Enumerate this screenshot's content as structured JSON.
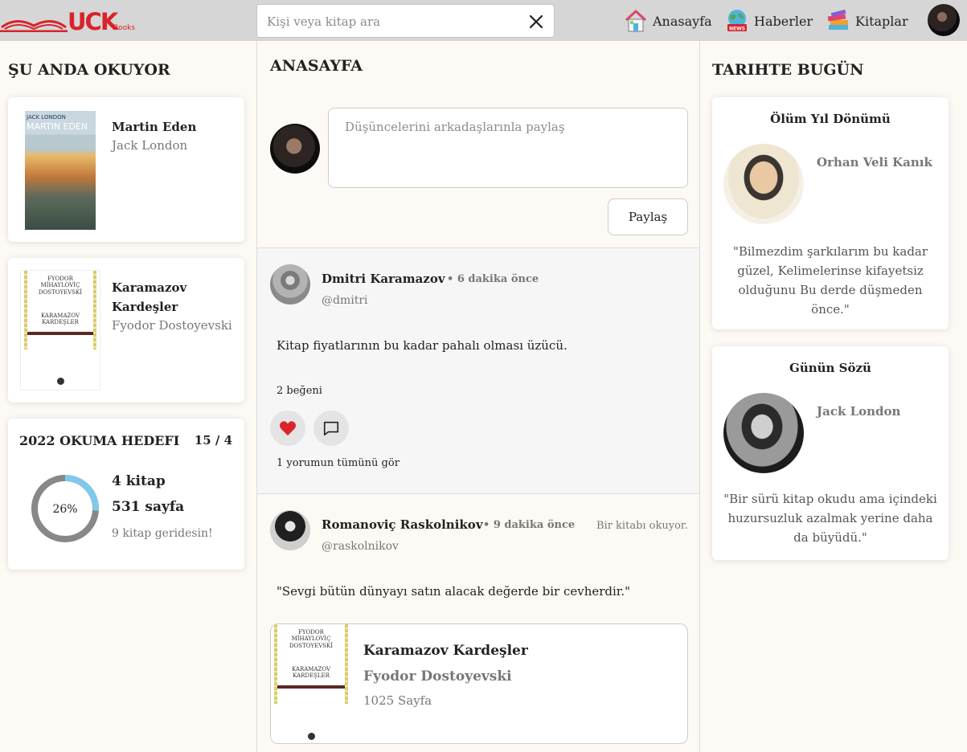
{
  "header": {
    "logo_text": "UCK",
    "logo_sub": "Books",
    "search_placeholder": "Kişi veya kitap ara",
    "nav": [
      {
        "label": "Anasayfa",
        "icon": "home-icon"
      },
      {
        "label": "Haberler",
        "icon": "news-globe-icon"
      },
      {
        "label": "Kitaplar",
        "icon": "books-icon"
      }
    ]
  },
  "left": {
    "reading_title": "ŞU ANDA OKUYOR",
    "books": [
      {
        "title": "Martin Eden",
        "author": "Jack London",
        "cover_top": "JACK LONDON",
        "cover_title": "MARTIN EDEN"
      },
      {
        "title": "Karamazov Kardeşler",
        "author": "Fyodor Dostoyevski",
        "cover_author": "FYODOR MİHAYLOVİÇ DOSTOYEVSKİ",
        "cover_title": "KARAMAZOV KARDEŞLER"
      }
    ],
    "goal": {
      "title": "2022 OKUMA HEDEFI",
      "ratio": "15 / 4",
      "percent_label": "26%",
      "percent": 26,
      "books_read": "4 kitap",
      "pages_read": "531 sayfa",
      "behind": "9 kitap geridesin!"
    }
  },
  "main": {
    "title": "ANASAYFA",
    "composer_placeholder": "Düşüncelerini arkadaşlarınla paylaş",
    "share_label": "Paylaş",
    "posts": [
      {
        "name": "Dmitri Karamazov",
        "time": "• 6 dakika önce",
        "handle": "@dmitri",
        "text": "Kitap fiyatlarının bu kadar pahalı olması üzücü.",
        "likes": "2 beğeni",
        "comments": "1 yorumun tümünü gör"
      },
      {
        "name": "Romanoviç Raskolnikov",
        "time": "• 9 dakika önce",
        "handle": "@raskolnikov",
        "note": "Bir kitabı okuyor.",
        "text": "\"Sevgi bütün dünyayı satın alacak değerde bir cevherdir.\"",
        "book": {
          "title": "Karamazov Kardeşler",
          "author": "Fyodor Dostoyevski",
          "pages": "1025 Sayfa"
        }
      }
    ]
  },
  "right": {
    "title": "TARIHTE BUGÜN",
    "cards": [
      {
        "heading": "Ölüm Yıl Dönümü",
        "name": "Orhan Veli Kanık",
        "quote_lines": [
          "\"Bilmezdim şarkılarım bu kadar",
          "güzel, Kelimelerinse kifayetsiz",
          "olduğunu Bu derde düşmeden",
          "önce.\""
        ]
      },
      {
        "heading": "Günün Sözü",
        "name": "Jack London",
        "quote_lines": [
          "\"Bir sürü kitap okudu ama içindeki",
          "huzursuzluk azalmak yerine daha",
          "da büyüdü.\""
        ]
      }
    ]
  },
  "colors": {
    "brand": "#d8232a",
    "header_bg": "#d6d6d6",
    "page_bg": "#fdfaf5",
    "heart": "#d9252b",
    "ring_track": "#888888",
    "ring_fill": "#80c8ec"
  }
}
